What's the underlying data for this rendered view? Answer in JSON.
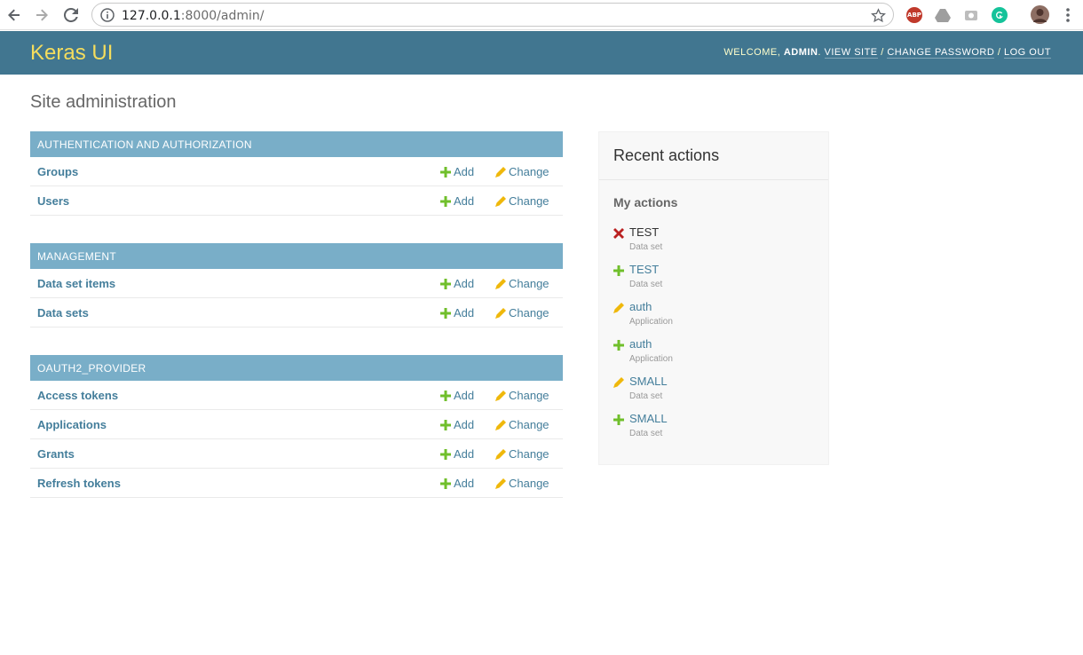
{
  "browser": {
    "url_host": "127.0.0.1",
    "url_rest": ":8000/admin/",
    "extensions": [
      "ABP"
    ]
  },
  "header": {
    "brand": "Keras UI",
    "welcome": "Welcome,",
    "user": "admin",
    "view_site": "View site",
    "change_password": "Change password",
    "log_out": "Log out"
  },
  "page_title": "Site administration",
  "modules": [
    {
      "caption": "Authentication and Authorization",
      "rows": [
        {
          "name": "Groups",
          "add": "Add",
          "change": "Change"
        },
        {
          "name": "Users",
          "add": "Add",
          "change": "Change"
        }
      ]
    },
    {
      "caption": "Management",
      "rows": [
        {
          "name": "Data set items",
          "add": "Add",
          "change": "Change"
        },
        {
          "name": "Data sets",
          "add": "Add",
          "change": "Change"
        }
      ]
    },
    {
      "caption": "Oauth2_Provider",
      "rows": [
        {
          "name": "Access tokens",
          "add": "Add",
          "change": "Change"
        },
        {
          "name": "Applications",
          "add": "Add",
          "change": "Change"
        },
        {
          "name": "Grants",
          "add": "Add",
          "change": "Change"
        },
        {
          "name": "Refresh tokens",
          "add": "Add",
          "change": "Change"
        }
      ]
    }
  ],
  "recent": {
    "title": "Recent actions",
    "subtitle": "My actions",
    "items": [
      {
        "kind": "delete",
        "title": "TEST",
        "type": "Data set"
      },
      {
        "kind": "add",
        "title": "TEST",
        "type": "Data set"
      },
      {
        "kind": "change",
        "title": "auth",
        "type": "Application"
      },
      {
        "kind": "add",
        "title": "auth",
        "type": "Application"
      },
      {
        "kind": "change",
        "title": "SMALL",
        "type": "Data set"
      },
      {
        "kind": "add",
        "title": "SMALL",
        "type": "Data set"
      }
    ]
  },
  "colors": {
    "header_bg": "#417690",
    "brand": "#f5dd5d",
    "caption_bg": "#79aec8",
    "link": "#447e9b",
    "add_icon": "#70bf2b",
    "change_icon": "#efb80b",
    "delete_icon": "#ba2121"
  }
}
